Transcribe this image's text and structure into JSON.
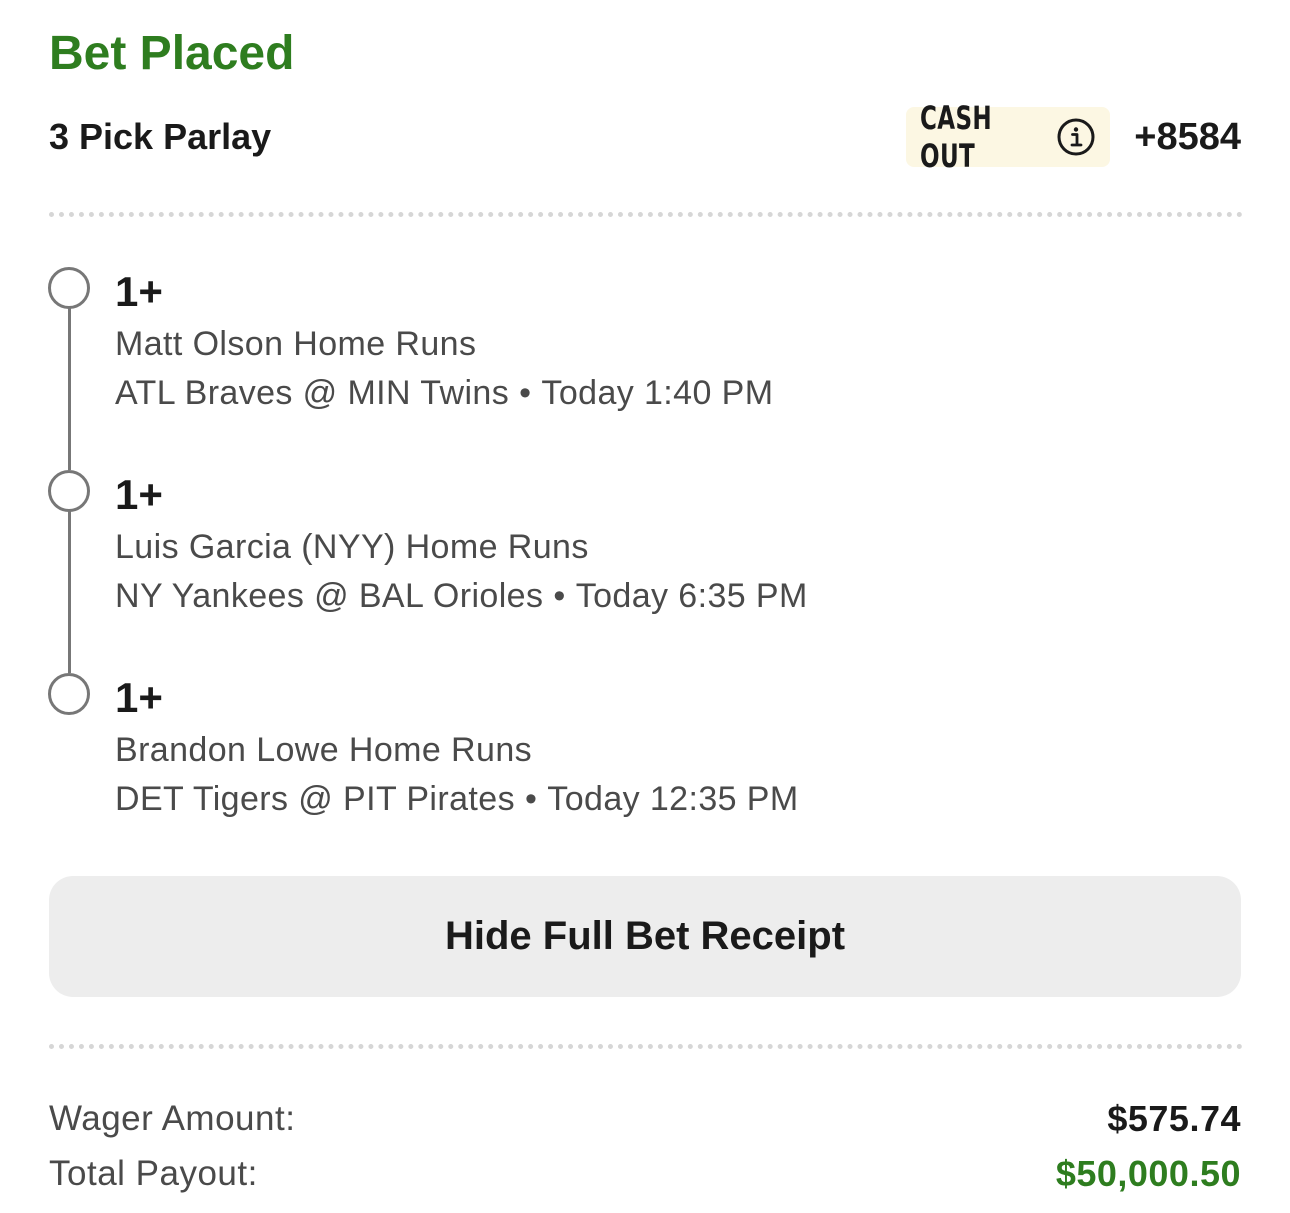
{
  "status_title": "Bet Placed",
  "bet": {
    "type_label": "3 Pick Parlay",
    "cashout_label": "CASH OUT",
    "odds": "+8584"
  },
  "legs": [
    {
      "line": "1+",
      "market": "Matt Olson Home Runs",
      "matchup": "ATL Braves @ MIN Twins",
      "separator": "•",
      "time": "Today 1:40 PM"
    },
    {
      "line": "1+",
      "market": "Luis Garcia (NYY) Home Runs",
      "matchup": "NY Yankees @ BAL Orioles",
      "separator": "•",
      "time": "Today 6:35 PM"
    },
    {
      "line": "1+",
      "market": "Brandon Lowe Home Runs",
      "matchup": "DET Tigers @ PIT Pirates",
      "separator": "•",
      "time": "Today 12:35 PM"
    }
  ],
  "receipt_button_label": "Hide Full Bet Receipt",
  "summary": {
    "wager_label": "Wager Amount:",
    "wager_value": "$575.74",
    "payout_label": "Total Payout:",
    "payout_value": "$50,000.50"
  },
  "colors": {
    "success_green": "#2e7d1f",
    "cashout_chip_bg": "#fcf7e3",
    "button_bg": "#ededed",
    "timeline_gray": "#777777"
  },
  "icons": {
    "cashout_info": "info-circle-icon",
    "leg_status": "open-circle-icon"
  }
}
